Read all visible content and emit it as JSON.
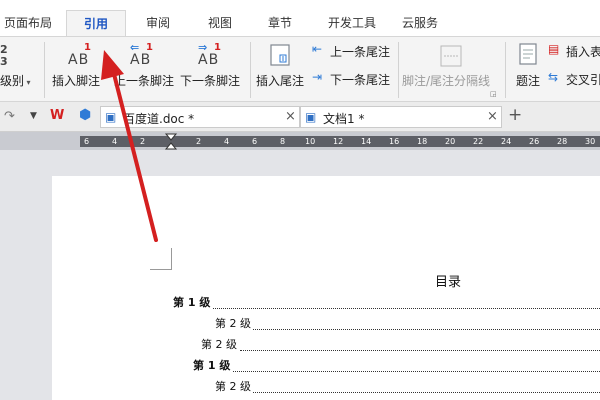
{
  "ribbon_tabs": [
    {
      "label": "页面布局"
    },
    {
      "label": "引用"
    },
    {
      "label": "审阅"
    },
    {
      "label": "视图"
    },
    {
      "label": "章节"
    },
    {
      "label": "开发工具"
    },
    {
      "label": "云服务"
    }
  ],
  "active_tab": "引用",
  "ribbon": {
    "level_label": "级别",
    "insert_footnote": "插入脚注",
    "prev_footnote": "上一条脚注",
    "next_footnote": "下一条脚注",
    "insert_endnote": "插入尾注",
    "prev_endnote": "上一条尾注",
    "next_endnote": "下一条尾注",
    "separator": "脚注/尾注分隔线",
    "caption": "题注",
    "insert_table": "插入表",
    "cross_ref": "交叉引",
    "ab_glyph": "AB",
    "footnote_mark": "1",
    "level_digits": "2\n3"
  },
  "doc_tabs": [
    {
      "label": "百度道.doc *"
    },
    {
      "label": "文档1 *"
    }
  ],
  "ruler_ticks": [
    "6",
    "4",
    "2",
    "2",
    "4",
    "6",
    "8",
    "10",
    "12",
    "14",
    "16",
    "18",
    "20",
    "22",
    "24",
    "26",
    "28",
    "30"
  ],
  "document": {
    "toc_title": "目录",
    "entries": [
      {
        "text": "第 1 级",
        "level": 1
      },
      {
        "text": "第 2 级",
        "level": 2
      },
      {
        "text": "第 2 级",
        "level": 2
      },
      {
        "text": "第 1 级",
        "level": 1
      },
      {
        "text": "第 2 级",
        "level": 2
      }
    ]
  },
  "colors": {
    "annotation_arrow": "#d42020",
    "active_tab_text": "#1f57c3"
  }
}
